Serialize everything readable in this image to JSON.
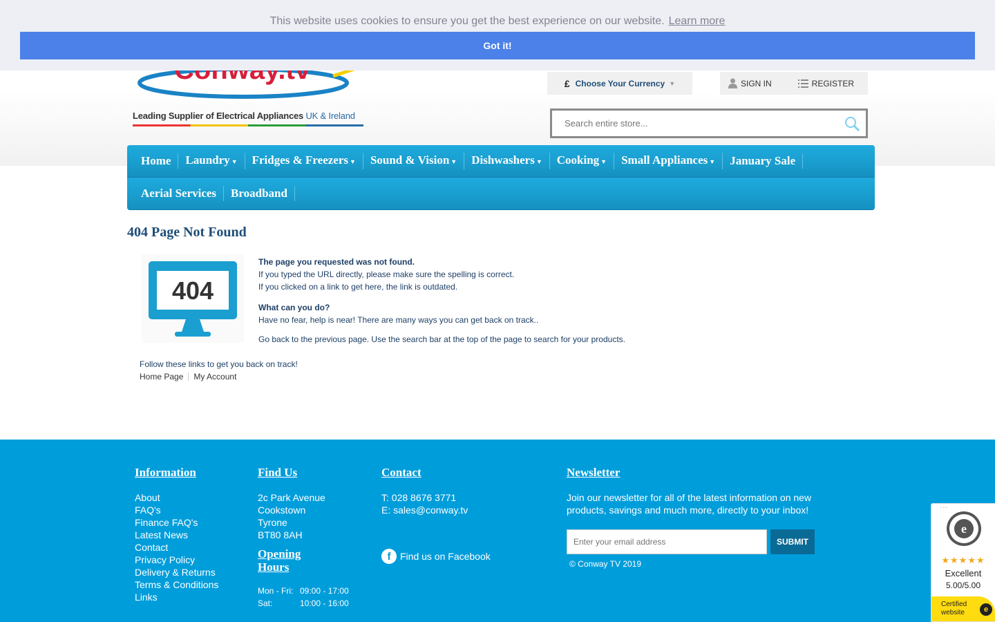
{
  "cookie": {
    "message": "This website uses cookies to ensure you get the best experience on our website.",
    "learn_more": "Learn more",
    "button": "Got it!"
  },
  "logo": {
    "brand": "Conway.tv",
    "tagline_main": "Leading Supplier of  Electrical Appliances",
    "tagline_region": "UK & Ireland"
  },
  "header": {
    "currency_symbol": "£",
    "currency_label": "Choose Your Currency",
    "sign_in": "SIGN IN",
    "register": "REGISTER",
    "search_placeholder": "Search entire store..."
  },
  "nav": {
    "row1": [
      {
        "label": "Home",
        "dropdown": false
      },
      {
        "label": "Laundry",
        "dropdown": true
      },
      {
        "label": "Fridges & Freezers",
        "dropdown": true
      },
      {
        "label": "Sound & Vision",
        "dropdown": true
      },
      {
        "label": "Dishwashers",
        "dropdown": true
      },
      {
        "label": "Cooking",
        "dropdown": true
      },
      {
        "label": "Small Appliances",
        "dropdown": true
      },
      {
        "label": "January Sale",
        "dropdown": false
      }
    ],
    "row2": [
      {
        "label": "Aerial Services",
        "dropdown": false
      },
      {
        "label": "Broadband",
        "dropdown": false
      }
    ]
  },
  "main": {
    "title": "404 Page Not Found",
    "monitor_text": "404",
    "not_found_heading": "The page you requested was not found.",
    "line1": "If you typed the URL directly, please make sure the spelling is correct.",
    "line2": "If you clicked on a link to get here, the link is outdated.",
    "what_heading": "What can you do?",
    "line3": "Have no fear, help is near! There are many ways you can get back on track..",
    "line4": "Go back to the previous page. Use the search bar at the top of the page to search for your products.",
    "follow": "Follow these links to get you back on track!",
    "link_home": "Home Page",
    "link_account": "My Account"
  },
  "footer": {
    "information": {
      "heading": "Information",
      "items": [
        "About",
        "FAQ's",
        "Finance FAQ's",
        "Latest News",
        "Contact",
        "Privacy Policy",
        "Delivery & Returns",
        "Terms & Conditions",
        "Links"
      ]
    },
    "find_us": {
      "heading": "Find Us",
      "address": [
        "2c Park Avenue",
        "Cookstown",
        "Tyrone",
        "BT80 8AH"
      ],
      "hours_heading_1": "Opening",
      "hours_heading_2": "Hours",
      "hours": [
        {
          "days": "Mon - Fri:",
          "time": "09:00 - 17:00"
        },
        {
          "days": "Sat:",
          "time": "10:00 - 16:00"
        }
      ]
    },
    "contact": {
      "heading": "Contact",
      "phone": "T: 028 8676 3771",
      "email": "E: sales@conway.tv",
      "facebook": "Find us on Facebook",
      "facebook_glyph": "f"
    },
    "newsletter": {
      "heading": "Newsletter",
      "text": "Join our newsletter for all of the latest information on new products, savings and much more, directly to your inbox!",
      "placeholder": "Enter your email address",
      "button": "SUBMIT",
      "copyright": "© Conway TV 2019"
    }
  },
  "trust_badge": {
    "stars": "★★★★★",
    "rating_label": "Excellent",
    "score": "5.00/5.00",
    "certified_1": "Certified",
    "certified_2": "website",
    "icon_glyph": "e",
    "dots": "···"
  },
  "colors": {
    "nav_blue": "#1a9fd0",
    "footer_blue": "#009ddb",
    "cookie_button": "#4b81e8",
    "title_navy": "#1e4d78"
  }
}
